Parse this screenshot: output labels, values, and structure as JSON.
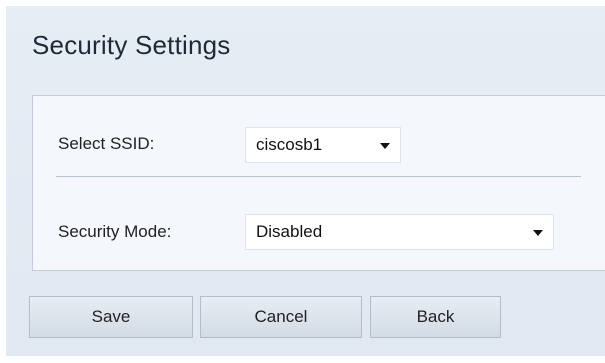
{
  "page": {
    "title": "Security Settings"
  },
  "form": {
    "ssid_label": "Select SSID:",
    "ssid_value": "ciscosb1",
    "security_mode_label": "Security Mode:",
    "security_mode_value": "Disabled"
  },
  "buttons": {
    "save": "Save",
    "cancel": "Cancel",
    "back": "Back"
  },
  "icons": {
    "dropdown": "chevron-down-icon"
  }
}
